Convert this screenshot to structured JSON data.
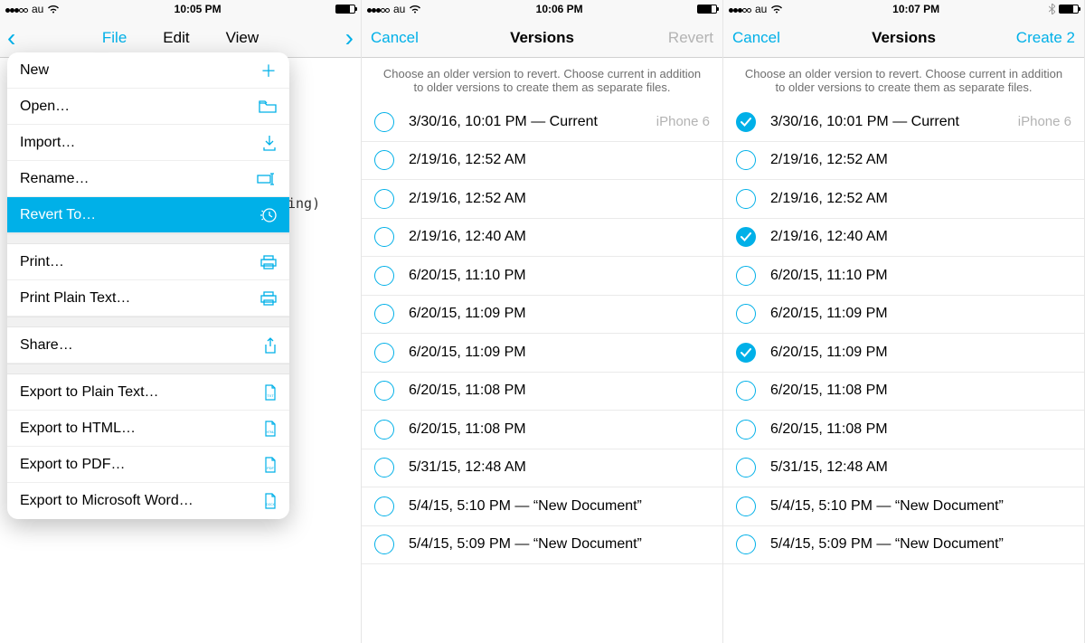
{
  "accent": "#00B0E8",
  "statusbar": {
    "carrier": "au",
    "times": [
      "10:05 PM",
      "10:06 PM",
      "10:07 PM"
    ]
  },
  "phone1": {
    "tabs": {
      "file": "File",
      "edit": "Edit",
      "view": "View"
    },
    "behind_text": "ing)",
    "menu": {
      "new": "New",
      "open": "Open…",
      "import": "Import…",
      "rename": "Rename…",
      "revert": "Revert To…",
      "print": "Print…",
      "print_plain": "Print Plain Text…",
      "share": "Share…",
      "export_txt": "Export to Plain Text…",
      "export_html": "Export to HTML…",
      "export_pdf": "Export to PDF…",
      "export_word": "Export to Microsoft Word…"
    }
  },
  "versions": {
    "nav": {
      "cancel": "Cancel",
      "title": "Versions",
      "revert": "Revert",
      "create2": "Create 2"
    },
    "instruction": "Choose an older version to revert. Choose current in addition to older versions to create them as separate files.",
    "device": "iPhone 6",
    "items": [
      {
        "label": "3/30/16, 10:01 PM — Current",
        "meta": true
      },
      {
        "label": "2/19/16, 12:52 AM"
      },
      {
        "label": "2/19/16, 12:52 AM"
      },
      {
        "label": "2/19/16, 12:40 AM"
      },
      {
        "label": "6/20/15, 11:10 PM"
      },
      {
        "label": "6/20/15, 11:09 PM"
      },
      {
        "label": "6/20/15, 11:09 PM"
      },
      {
        "label": "6/20/15, 11:08 PM"
      },
      {
        "label": "6/20/15, 11:08 PM"
      },
      {
        "label": "5/31/15, 12:48 AM"
      },
      {
        "label": "5/4/15, 5:10 PM — “New Document”"
      },
      {
        "label": "5/4/15, 5:09 PM — “New Document”"
      }
    ],
    "phone3_checked": [
      0,
      3,
      6
    ]
  }
}
